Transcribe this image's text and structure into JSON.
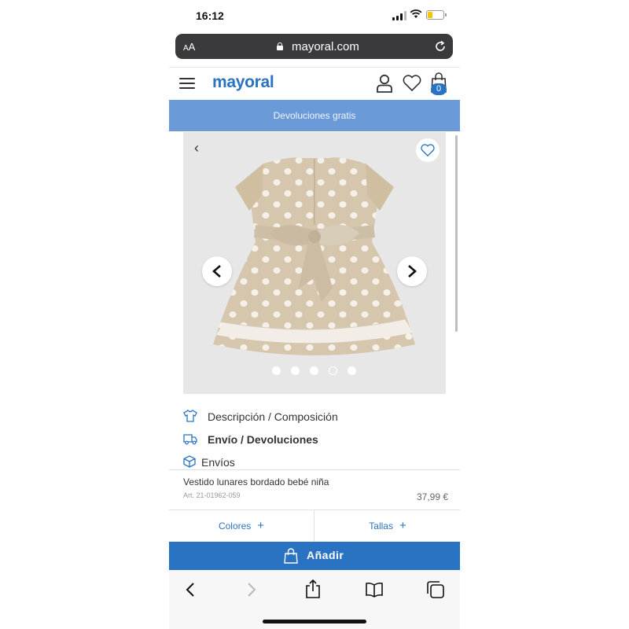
{
  "status_bar": {
    "time": "16:12"
  },
  "browser": {
    "text_size_label_small": "A",
    "text_size_label_big": "A",
    "url": "mayoral.com"
  },
  "header": {
    "logo": "mayoral",
    "bag_count": "0"
  },
  "banner": {
    "text": "Devoluciones gratis"
  },
  "gallery": {
    "back_glyph": "‹",
    "dot_count": 5,
    "active_dot_index": 3
  },
  "info_rows": [
    {
      "label": "Descripción / Composición",
      "icon": "tshirt-icon"
    },
    {
      "label": "Envío / Devoluciones",
      "icon": "truck-icon"
    },
    {
      "label": "Envíos",
      "icon": "box-icon"
    }
  ],
  "product": {
    "name": "Vestido lunares bordado bebé niña",
    "article": "Art. 21-01962-059",
    "price": "37,99 €"
  },
  "options": {
    "colors_label": "Colores",
    "sizes_label": "Tallas",
    "plus": "+"
  },
  "add_button": {
    "label": "Añadir"
  },
  "colors": {
    "brand_blue": "#2a73c2",
    "banner_blue": "#6b9ad8",
    "dress_beige": "#d6c6ad"
  }
}
